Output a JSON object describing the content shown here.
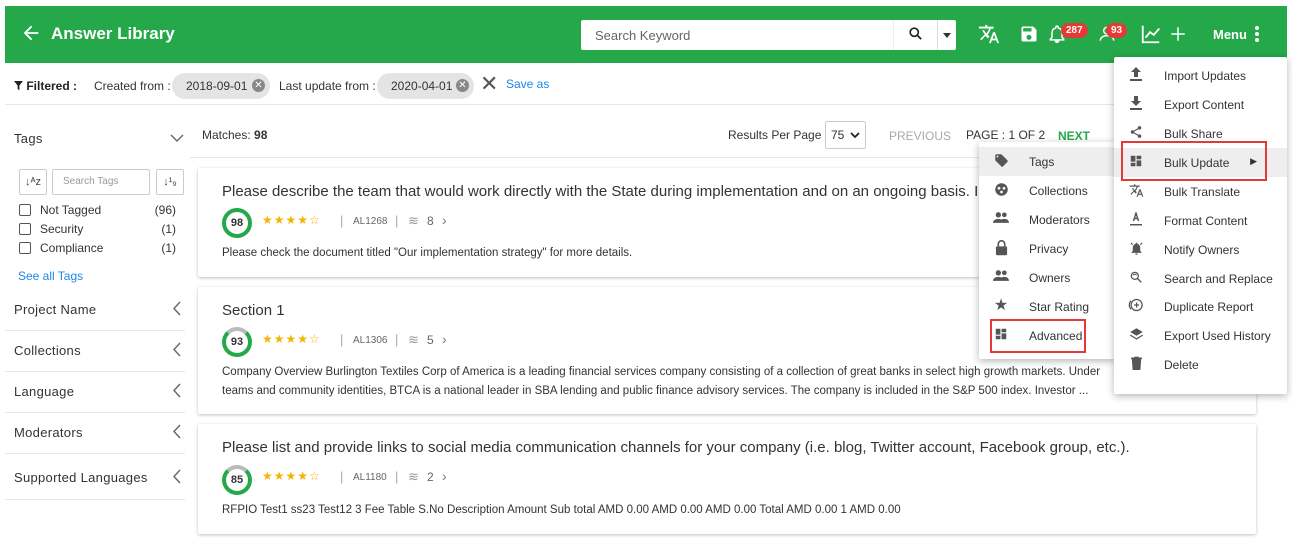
{
  "header": {
    "title": "Answer Library",
    "search_placeholder": "Search Keyword",
    "notifications_count": "287",
    "users_count": "93",
    "menu_label": "Menu",
    "colors": {
      "header_bg": "#25a84a",
      "badge": "#e53935",
      "highlight": "#e53935"
    }
  },
  "filters": {
    "label": "Filtered :",
    "created_from_label": "Created from :",
    "created_from_value": "2018-09-01",
    "last_update_label": "Last update from :",
    "last_update_value": "2020-04-01",
    "save_as": "Save as"
  },
  "sidebar": {
    "tags_title": "Tags",
    "tag_search_placeholder": "Search Tags",
    "tags": [
      {
        "name": "Not Tagged",
        "count": "(96)"
      },
      {
        "name": "Security",
        "count": "(1)"
      },
      {
        "name": "Compliance",
        "count": "(1)"
      }
    ],
    "see_all": "See all Tags",
    "facets": [
      "Project Name",
      "Collections",
      "Language",
      "Moderators",
      "Supported Languages"
    ]
  },
  "results": {
    "matches_label": "Matches:",
    "matches_value": "98",
    "rpp_label": "Results Per Page",
    "rpp_value": "75",
    "previous": "PREVIOUS",
    "page_info": "PAGE : 1 OF 2",
    "next": "NEXT"
  },
  "cards": [
    {
      "title": "Please describe the team that would work directly with the State during implementation and on an ongoing basis. Inc",
      "score": "98",
      "stars": 4,
      "id": "AL1268",
      "count": "8",
      "body": [
        "Please check the document titled \"Our implementation strategy\" for more details."
      ]
    },
    {
      "title": "Section 1",
      "score": "93",
      "stars": 4,
      "id": "AL1306",
      "count": "5",
      "body": [
        "Company Overview Burlington Textiles Corp of America is a leading financial services company consisting of a collection of great banks in select high growth markets. Under",
        "teams and community identities, BTCA is a national leader in SBA lending and public finance advisory services. The company is included in the S&P 500 index. Investor ..."
      ]
    },
    {
      "title": "Please list and provide links to social media communication channels for your company (i.e. blog, Twitter account, Facebook group, etc.).",
      "score": "85",
      "stars": 4,
      "id": "AL1180",
      "count": "2",
      "body": [
        "RFPIO Test1 ss23 Test12 3 Fee Table S.No Description Amount Sub total AMD 0.00 AMD 0.00 AMD 0.00 Total AMD 0.00 1 AMD 0.00"
      ]
    }
  ],
  "bulk_update_submenu": [
    {
      "label": "Tags",
      "icon": "tag-icon"
    },
    {
      "label": "Collections",
      "icon": "collections-icon"
    },
    {
      "label": "Moderators",
      "icon": "people-icon"
    },
    {
      "label": "Privacy",
      "icon": "lock-icon"
    },
    {
      "label": "Owners",
      "icon": "people-icon"
    },
    {
      "label": "Star Rating",
      "icon": "star-icon"
    },
    {
      "label": "Advanced",
      "icon": "dashboard-icon"
    }
  ],
  "main_menu": [
    {
      "label": "Import Updates",
      "icon": "upload-icon"
    },
    {
      "label": "Export Content",
      "icon": "download-icon"
    },
    {
      "label": "Bulk Share",
      "icon": "share-icon"
    },
    {
      "label": "Bulk Update",
      "icon": "dashboard-icon"
    },
    {
      "label": "Bulk Translate",
      "icon": "translate-icon"
    },
    {
      "label": "Format Content",
      "icon": "format-icon"
    },
    {
      "label": "Notify Owners",
      "icon": "alarm-icon"
    },
    {
      "label": "Search and Replace",
      "icon": "find-replace-icon"
    },
    {
      "label": "Duplicate Report",
      "icon": "duplicate-icon"
    },
    {
      "label": "Export Used History",
      "icon": "layers-icon"
    },
    {
      "label": "Delete",
      "icon": "trash-icon"
    }
  ]
}
